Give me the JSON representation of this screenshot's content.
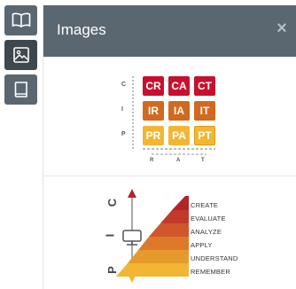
{
  "tabs": [
    {
      "icon": "book-open-icon"
    },
    {
      "icon": "image-icon"
    },
    {
      "icon": "book-icon"
    }
  ],
  "panel": {
    "title": "Images",
    "close_label": "×"
  },
  "grid_image": {
    "rows": [
      {
        "axis": "C",
        "cells": [
          "CR",
          "CA",
          "CT"
        ]
      },
      {
        "axis": "I",
        "cells": [
          "IR",
          "IA",
          "IT"
        ]
      },
      {
        "axis": "P",
        "cells": [
          "PR",
          "PA",
          "PT"
        ]
      }
    ],
    "columns": [
      "R",
      "A",
      "T"
    ],
    "colors": {
      "red": "#c8102e",
      "orange": "#d2691e",
      "yellow": "#f2b632"
    }
  },
  "pyramid_image": {
    "left_axis": [
      "C",
      "I",
      "P"
    ],
    "levels": [
      "CREATE",
      "EVALUATE",
      "ANALYZE",
      "APPLY",
      "UNDERSTAND",
      "REMEMBER"
    ]
  }
}
